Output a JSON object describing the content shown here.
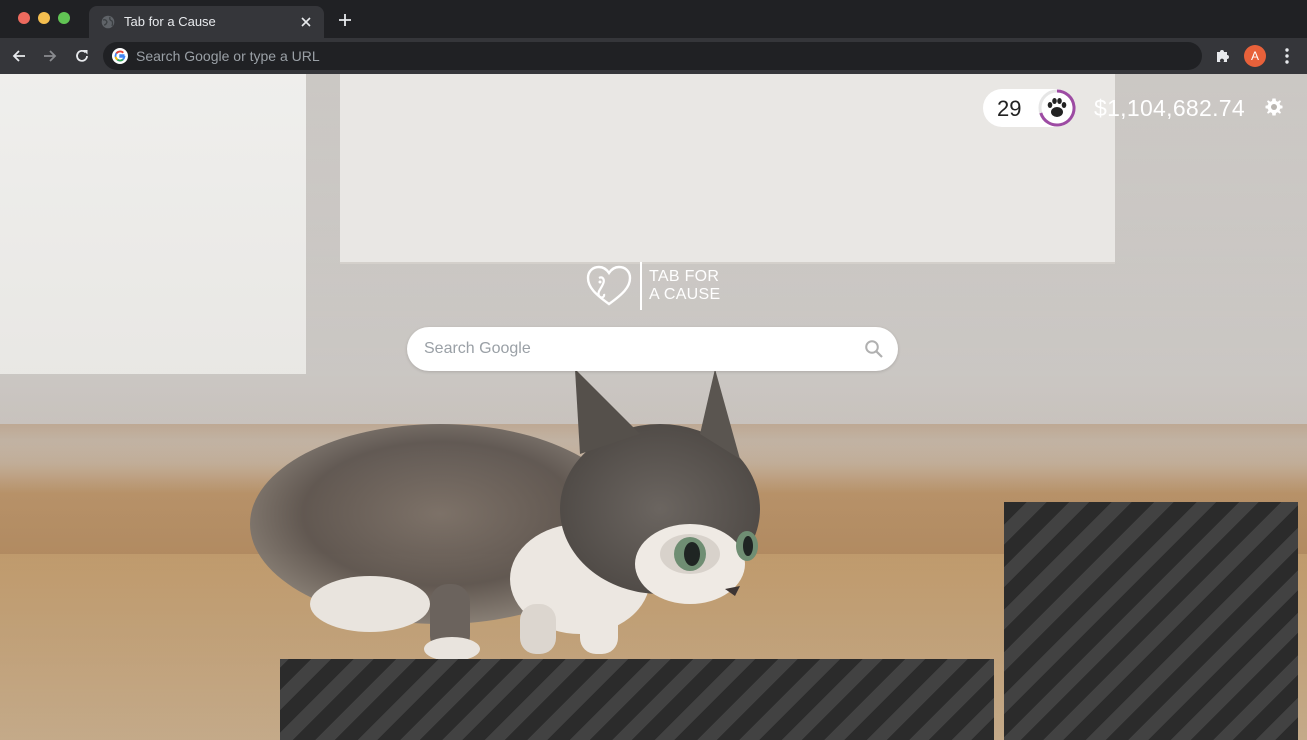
{
  "browser": {
    "tab": {
      "title": "Tab for a Cause",
      "favicon": "globe-icon",
      "close": "close-icon"
    },
    "new_tab": "plus-icon",
    "omnibox": {
      "placeholder": "Search Google or type a URL",
      "value": ""
    },
    "profile_initial": "A",
    "profile_color": "#e8613a"
  },
  "page": {
    "hearts_count": "29",
    "hearts_icon": "paw-icon",
    "money_raised": "$1,104,682.74",
    "settings_icon": "gear-icon",
    "logo": {
      "line1": "TAB FOR",
      "line2": "A CAUSE"
    },
    "search": {
      "placeholder": "Search Google",
      "value": ""
    },
    "accent_color": "#9d4ba3"
  }
}
